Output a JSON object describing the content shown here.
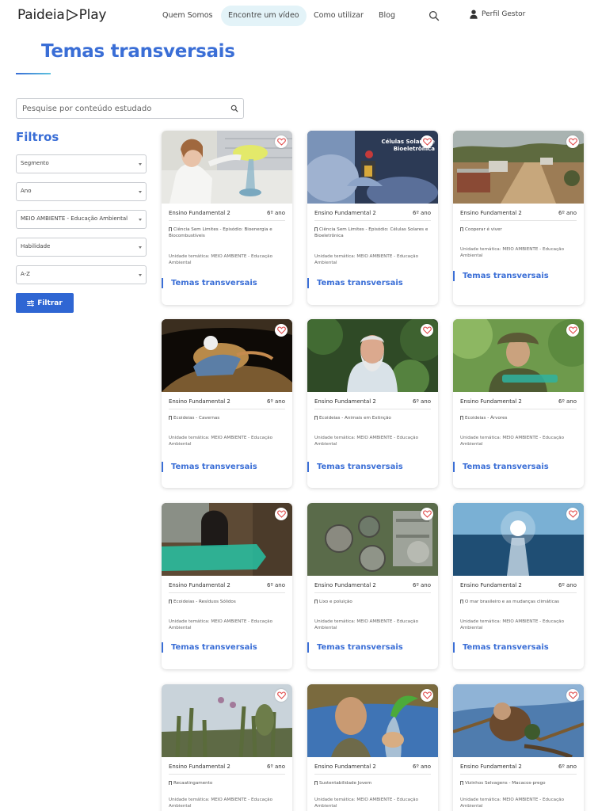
{
  "header": {
    "logo_left": "Paideia",
    "logo_right": "Play",
    "nav": [
      "Quem Somos",
      "Encontre um vídeo",
      "Como utilizar",
      "Blog"
    ],
    "profile": "Perfil Gestor"
  },
  "page": {
    "title": "Temas transversais"
  },
  "search": {
    "placeholder": "Pesquise por conteúdo estudado"
  },
  "filters": {
    "title": "Filtros",
    "selects": [
      "Segmento",
      "Ano",
      "MEIO AMBIENTE - Educação Ambiental",
      "Habilidade",
      "A-Z"
    ],
    "button": "Filtrar"
  },
  "cards": [
    {
      "segment": "Ensino Fundamental 2",
      "grade": "6º ano",
      "episode": "Ciência Sem Limites - Episódio: Bioenergia e Biocombustíveis",
      "unit": "Unidade temática: MEIO AMBIENTE - Educação Ambiental",
      "tag": "Temas transversais"
    },
    {
      "segment": "Ensino Fundamental 2",
      "grade": "6º ano",
      "episode": "Ciência Sem Limites - Episódio: Células Solares e Bioeletrônica",
      "unit": "Unidade temática: MEIO AMBIENTE - Educação Ambiental",
      "tag": "Temas transversais",
      "thumb_text": "Células Solares e Bioeletrônica"
    },
    {
      "segment": "Ensino Fundamental 2",
      "grade": "6º ano",
      "episode": "Cooperar é viver",
      "unit": "Unidade temática: MEIO AMBIENTE - Educação Ambiental",
      "tag": "Temas transversais"
    },
    {
      "segment": "Ensino Fundamental 2",
      "grade": "6º ano",
      "episode": "Ecoideias - Cavernas",
      "unit": "Unidade temática: MEIO AMBIENTE - Educação Ambiental",
      "tag": "Temas transversais"
    },
    {
      "segment": "Ensino Fundamental 2",
      "grade": "6º ano",
      "episode": "Ecoideias - Animais em Extinção",
      "unit": "Unidade temática: MEIO AMBIENTE - Educação Ambiental",
      "tag": "Temas transversais"
    },
    {
      "segment": "Ensino Fundamental 2",
      "grade": "6º ano",
      "episode": "Ecoideias - Árvores",
      "unit": "Unidade temática: MEIO AMBIENTE - Educação Ambiental",
      "tag": "Temas transversais"
    },
    {
      "segment": "Ensino Fundamental 2",
      "grade": "6º ano",
      "episode": "Ecoideias - Resíduos Sólidos",
      "unit": "Unidade temática: MEIO AMBIENTE - Educação Ambiental",
      "tag": "Temas transversais"
    },
    {
      "segment": "Ensino Fundamental 2",
      "grade": "6º ano",
      "episode": "Lixo e poluição",
      "unit": "Unidade temática: MEIO AMBIENTE - Educação Ambiental",
      "tag": "Temas transversais"
    },
    {
      "segment": "Ensino Fundamental 2",
      "grade": "6º ano",
      "episode": "O mar brasileiro e as mudanças climáticas",
      "unit": "Unidade temática: MEIO AMBIENTE - Educação Ambiental",
      "tag": "Temas transversais"
    },
    {
      "segment": "Ensino Fundamental 2",
      "grade": "6º ano",
      "episode": "Recaatingamento",
      "unit": "Unidade temática: MEIO AMBIENTE - Educação Ambiental",
      "tag": "Temas transversais"
    },
    {
      "segment": "Ensino Fundamental 2",
      "grade": "6º ano",
      "episode": "Sustentabilidade Jovem",
      "unit": "Unidade temática: MEIO AMBIENTE - Educação Ambiental",
      "tag": "Temas transversais"
    },
    {
      "segment": "Ensino Fundamental 2",
      "grade": "6º ano",
      "episode": "Vizinhos Selvagens - Macacos-prego",
      "unit": "Unidade temática: MEIO AMBIENTE - Educação Ambiental",
      "tag": "Temas transversais"
    }
  ],
  "colors": {
    "accent": "#3a6ed6",
    "button": "#2f66d3",
    "nav_active_bg": "#e3f3f8",
    "heart": "#e04a4a"
  }
}
